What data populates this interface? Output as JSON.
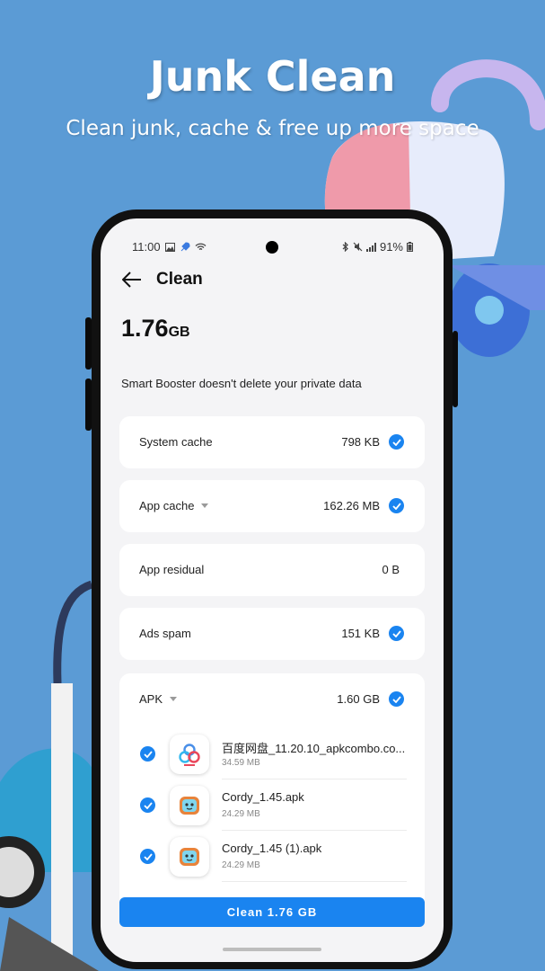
{
  "promo": {
    "title": "Junk Clean",
    "subtitle": "Clean junk, cache & free up more space"
  },
  "status_bar": {
    "time": "11:00",
    "battery": "91%"
  },
  "app_bar": {
    "title": "Clean"
  },
  "summary": {
    "total_value": "1.76",
    "total_unit": "GB",
    "note": "Smart Booster doesn't delete your private data"
  },
  "categories": [
    {
      "label": "System cache",
      "size": "798 KB",
      "checked": true
    },
    {
      "label": "App cache",
      "size": "162.26 MB",
      "checked": true,
      "expandable": true
    },
    {
      "label": "App residual",
      "size": "0 B",
      "checked": false
    },
    {
      "label": "Ads spam",
      "size": "151 KB",
      "checked": true
    },
    {
      "label": "APK",
      "size": "1.60 GB",
      "checked": true,
      "expandable": true
    }
  ],
  "apks": [
    {
      "name": "百度网盘_11.20.10_apkcombo.co...",
      "size": "34.59 MB",
      "checked": true,
      "icon": "baidu-netdisk-icon"
    },
    {
      "name": "Cordy_1.45.apk",
      "size": "24.29 MB",
      "checked": true,
      "icon": "cordy-robot-icon"
    },
    {
      "name": "Cordy_1.45 (1).apk",
      "size": "24.29 MB",
      "checked": true,
      "icon": "cordy-robot-icon"
    }
  ],
  "clean_button": {
    "label": "Clean 1.76 GB"
  },
  "colors": {
    "background": "#5b9bd5",
    "accent": "#1a84f0",
    "screen": "#f4f4f6"
  }
}
